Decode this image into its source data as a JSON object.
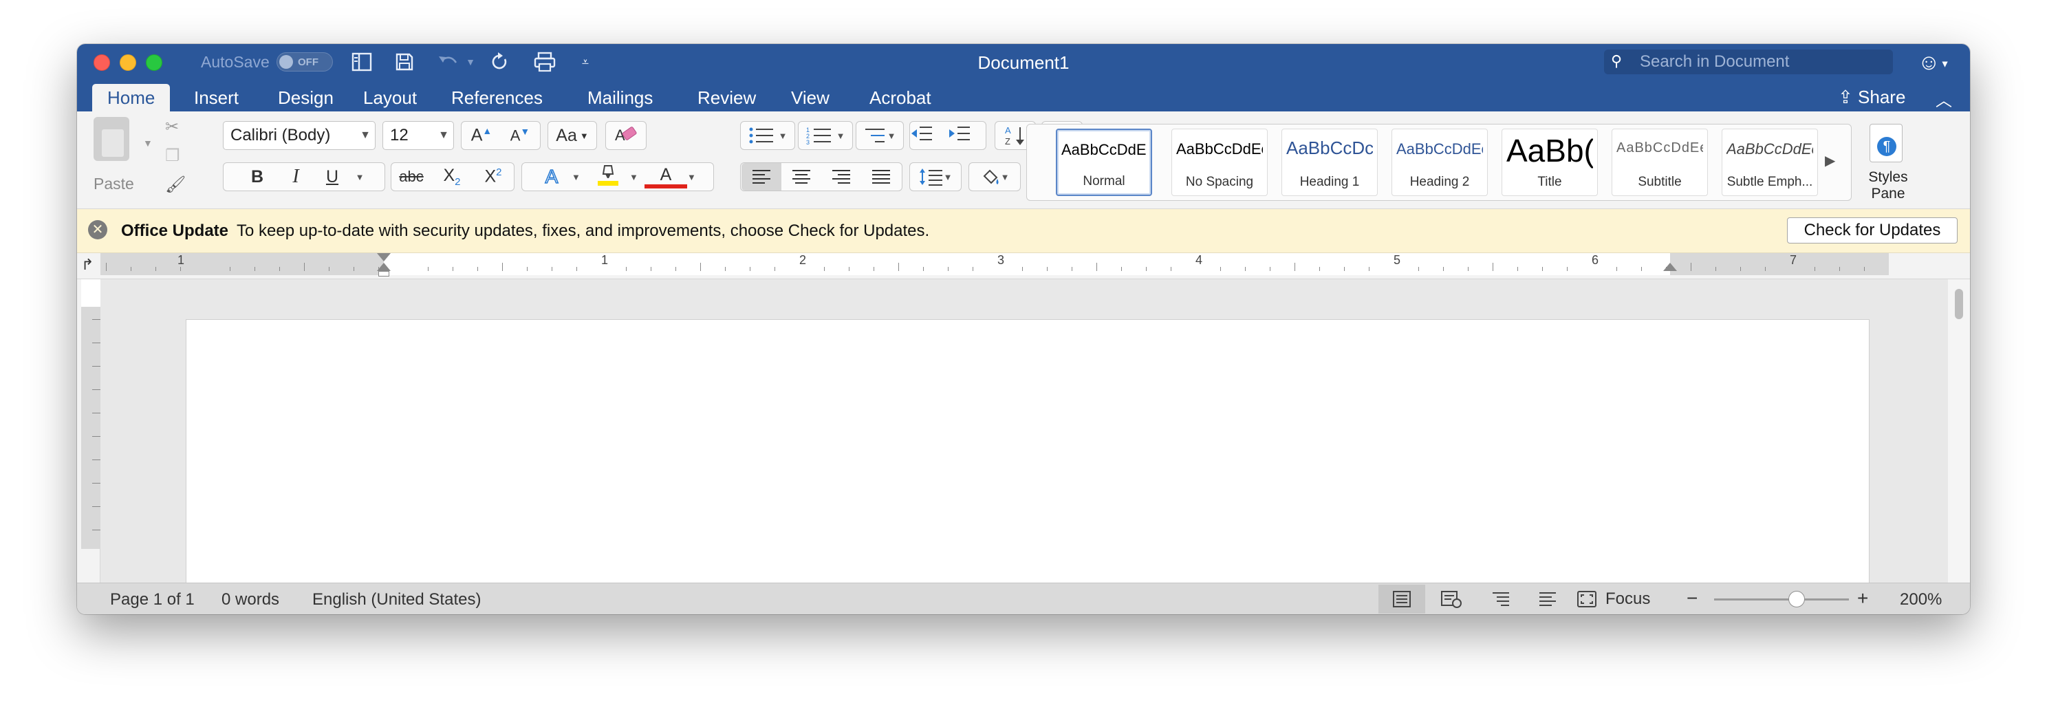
{
  "window": {
    "title": "Document1",
    "autosave_label": "AutoSave",
    "autosave_state": "OFF"
  },
  "search": {
    "placeholder": "Search in Document"
  },
  "tabs": [
    {
      "label": "Home",
      "active": true
    },
    {
      "label": "Insert"
    },
    {
      "label": "Design"
    },
    {
      "label": "Layout"
    },
    {
      "label": "References"
    },
    {
      "label": "Mailings"
    },
    {
      "label": "Review"
    },
    {
      "label": "View"
    },
    {
      "label": "Acrobat"
    }
  ],
  "share_label": "Share",
  "ribbon": {
    "paste_label": "Paste",
    "font_name": "Calibri (Body)",
    "font_size": "12",
    "bold": "B",
    "italic": "I",
    "underline": "U",
    "strike": "abc",
    "subscript": "X",
    "subscript_mark": "2",
    "superscript": "X",
    "superscript_mark": "2",
    "text_effects": "A",
    "font_color": "A",
    "grow_font": "A",
    "shrink_font": "A",
    "change_case": "Aa",
    "show_marks": "¶",
    "styles": [
      {
        "preview": "AaBbCcDdEe",
        "name": "Normal",
        "selected": true
      },
      {
        "preview": "AaBbCcDdEe",
        "name": "No Spacing"
      },
      {
        "preview": "AaBbCcDc",
        "name": "Heading 1"
      },
      {
        "preview": "AaBbCcDdEe",
        "name": "Heading 2"
      },
      {
        "preview": "AaBb(",
        "name": "Title"
      },
      {
        "preview": "AaBbCcDdEe",
        "name": "Subtitle"
      },
      {
        "preview": "AaBbCcDdEe",
        "name": "Subtle Emph..."
      }
    ],
    "styles_pane_line1": "Styles",
    "styles_pane_line2": "Pane"
  },
  "update_bar": {
    "title": "Office Update",
    "message": "To keep up-to-date with security updates, fixes, and improvements, choose Check for Updates.",
    "button": "Check for Updates"
  },
  "ruler_numbers": [
    "1",
    "1",
    "2",
    "3",
    "4",
    "5",
    "6",
    "7"
  ],
  "status": {
    "page": "Page 1 of 1",
    "words": "0 words",
    "language": "English (United States)",
    "focus": "Focus",
    "zoom_minus": "−",
    "zoom_plus": "+",
    "zoom": "200%"
  },
  "colors": {
    "brand": "#2b579a",
    "highlight": "#ffe600",
    "font_color": "#e0231b",
    "update_bar_bg": "#fdf4d3"
  }
}
